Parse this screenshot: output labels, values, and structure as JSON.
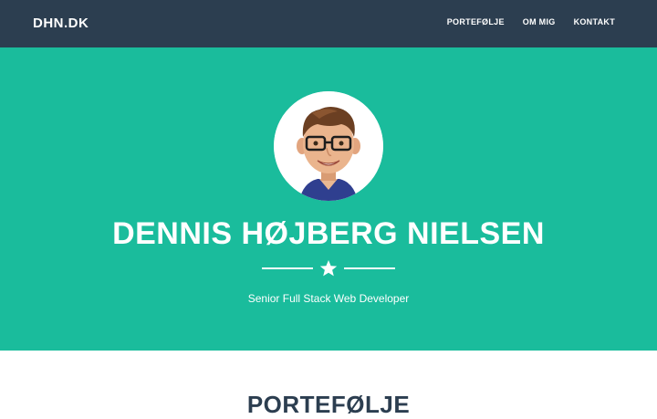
{
  "navbar": {
    "brand": "DHN.DK",
    "links": [
      "PORTEFØLJE",
      "OM MIG",
      "KONTAKT"
    ]
  },
  "masthead": {
    "avatar_icon": "caricature-avatar",
    "heading": "DENNIS HØJBERG NIELSEN",
    "divider_icon": "star-icon",
    "subheading": "Senior Full Stack Web Developer"
  },
  "portfolio": {
    "heading": "PORTEFØLJE"
  },
  "colors": {
    "navbar": "#2c3e50",
    "masthead": "#1abc9c",
    "text_light": "#ffffff",
    "text_dark": "#2c3e50"
  }
}
